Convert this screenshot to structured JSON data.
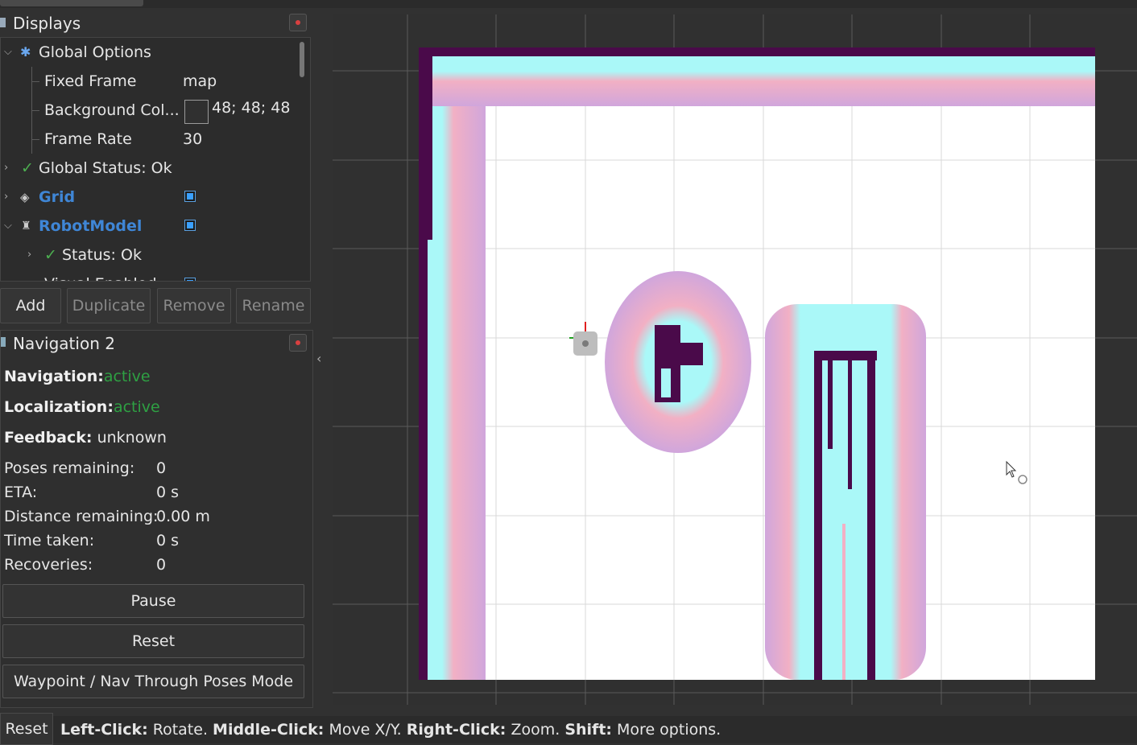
{
  "displays": {
    "title": "Displays",
    "tree": {
      "global_options": "Global Options",
      "fixed_frame_label": "Fixed Frame",
      "fixed_frame_value": "map",
      "background_label": "Background Col...",
      "background_value": "48; 48; 48",
      "frame_rate_label": "Frame Rate",
      "frame_rate_value": "30",
      "global_status": "Global Status: Ok",
      "grid": "Grid",
      "robot_model": "RobotModel",
      "status_ok": "Status: Ok",
      "visual_enabled": "Visual Enabled"
    },
    "buttons": {
      "add": "Add",
      "duplicate": "Duplicate",
      "remove": "Remove",
      "rename": "Rename"
    }
  },
  "navigation": {
    "title": "Navigation 2",
    "navigation_label": "Navigation:",
    "navigation_value": "active",
    "localization_label": "Localization:",
    "localization_value": "active",
    "feedback_label": "Feedback:",
    "feedback_value": "unknown",
    "stats": [
      {
        "label": "Poses remaining:",
        "value": "0"
      },
      {
        "label": "ETA:",
        "value": "0 s"
      },
      {
        "label": "Distance remaining:",
        "value": "0.00 m"
      },
      {
        "label": "Time taken:",
        "value": "0 s"
      },
      {
        "label": "Recoveries:",
        "value": "0"
      }
    ],
    "buttons": {
      "pause": "Pause",
      "reset": "Reset",
      "mode": "Waypoint / Nav Through Poses Mode"
    }
  },
  "statusbar": {
    "reset": "Reset",
    "left_click_key": "Left-Click:",
    "left_click_action": " Rotate. ",
    "middle_click_key": "Middle-Click:",
    "middle_click_action": " Move X/Y. ",
    "right_click_key": "Right-Click:",
    "right_click_action": " Zoom. ",
    "shift_key": "Shift:",
    "shift_action": " More options."
  },
  "colors": {
    "background": "#303030",
    "occupied": "#4a0a4a",
    "inflation_cyan": "#aaf8f8",
    "inflation_pink": "#f2b0c4",
    "inflation_lavender": "#d0a6dc",
    "free": "#ffffff",
    "active_green": "#2ea043",
    "display_blue": "#3f86d6"
  }
}
